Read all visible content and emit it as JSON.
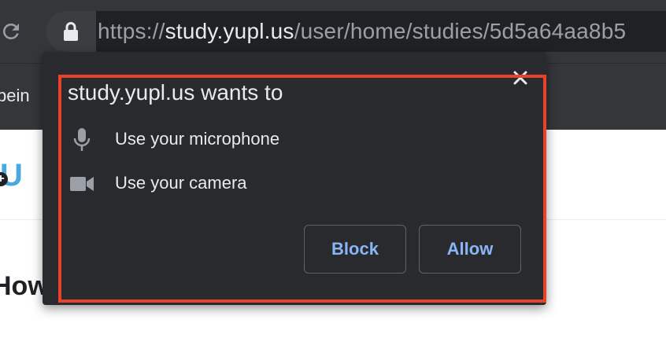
{
  "browser": {
    "url": {
      "scheme": "https",
      "separator": "://",
      "host": "study.yupl.us",
      "path": "/user/home/studies/5d5a64aa8b5"
    },
    "bookmark_partial": "bein"
  },
  "page": {
    "logo_partial": "U",
    "heading_partial": "How"
  },
  "permission_popup": {
    "title": "study.yupl.us wants to",
    "permissions": [
      {
        "icon": "microphone-icon",
        "label": "Use your microphone"
      },
      {
        "icon": "camera-icon",
        "label": "Use your camera"
      }
    ],
    "block_label": "Block",
    "allow_label": "Allow",
    "highlight_color": "#e8412c",
    "button_text_color": "#8ab4f8"
  }
}
